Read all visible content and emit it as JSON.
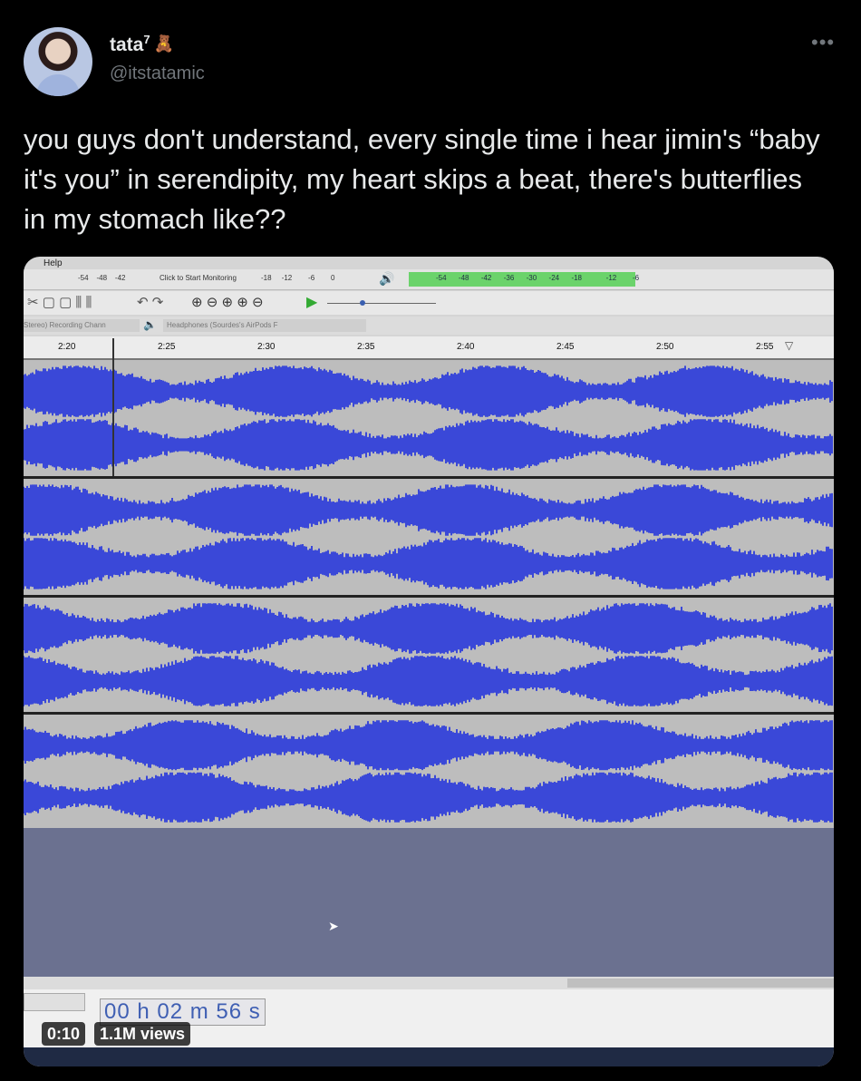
{
  "tweet": {
    "display_name": "tata",
    "name_superscript": "7",
    "name_emoji_icon": "teddy-bear-icon",
    "handle": "@itstatamic",
    "more_icon": "more-options-icon",
    "text": "you guys don't understand, every single time i hear jimin's “baby it's you” in serendipity, my heart skips a beat, there's butterflies in my stomach like??"
  },
  "video": {
    "elapsed": "0:10",
    "views": "1.1M views",
    "audacity": {
      "menu_help": "Help",
      "monitor_label": "Click to Start Monitoring",
      "recording_channels": "Stereo) Recording Chann",
      "playback_device": "Headphones (Sourdes's AirPods F",
      "ruler_ticks": [
        "2:20",
        "2:25",
        "2:30",
        "2:35",
        "2:40",
        "2:45",
        "2:50",
        "2:55"
      ],
      "meter_ticks_left": [
        "-54",
        "-48",
        "-42"
      ],
      "meter_ticks_mid": [
        "-18",
        "-12",
        "-6",
        "0"
      ],
      "meter_ticks_right": [
        "-54",
        "-48",
        "-42",
        "-36",
        "-30",
        "-24",
        "-18",
        "-12",
        "-6"
      ],
      "selection_time": "00 h 02 m 56 s",
      "waveform_color": "#3a48d8",
      "track_bg_color": "#bdbdbd"
    }
  }
}
